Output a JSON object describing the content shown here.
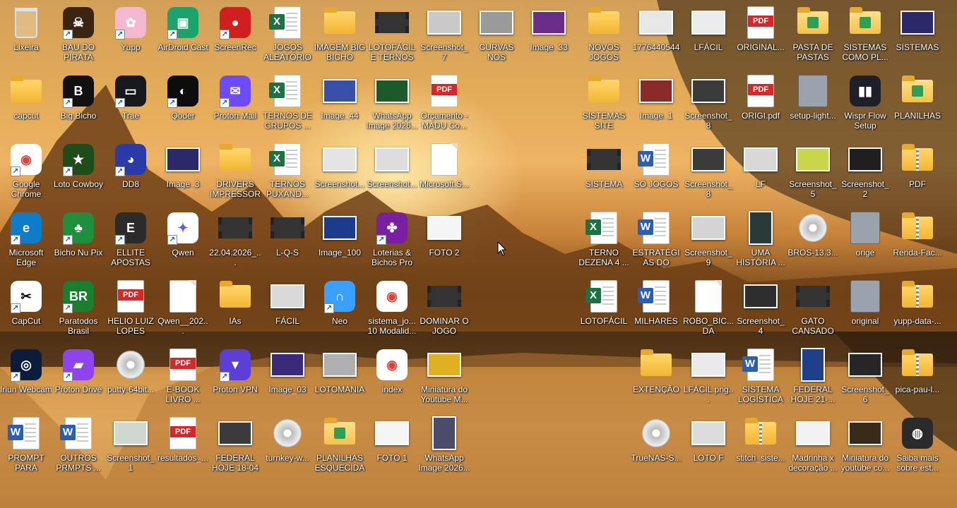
{
  "desktop": {
    "icons": [
      {
        "label": "Lixeira",
        "kind": "trash",
        "shortcut": false,
        "col": 0,
        "row": 0
      },
      {
        "label": "BAU DO PIRATA",
        "kind": "app",
        "color": "#3a2412",
        "glyph": "☠",
        "shortcut": true,
        "col": 1,
        "row": 0
      },
      {
        "label": "Yupp",
        "kind": "app",
        "color": "#f3b8d0",
        "glyph": "✿",
        "shortcut": true,
        "col": 2,
        "row": 0
      },
      {
        "label": "AirDroid Cast",
        "kind": "app",
        "color": "#1aa36b",
        "glyph": "▣",
        "shortcut": true,
        "col": 3,
        "row": 0
      },
      {
        "label": "ScreenRec",
        "kind": "app",
        "color": "#d01f1f",
        "glyph": "●",
        "shortcut": true,
        "col": 4,
        "row": 0
      },
      {
        "label": "JOGOS ALEATÓRIOS",
        "kind": "excel",
        "shortcut": false,
        "col": 5,
        "row": 0
      },
      {
        "label": "IMAGEM BIG BICHO",
        "kind": "folder",
        "shortcut": false,
        "col": 6,
        "row": 0
      },
      {
        "label": "LOTOFÁCIL E TERNOS D...",
        "kind": "video",
        "shortcut": false,
        "col": 7,
        "row": 0
      },
      {
        "label": "Screenshot_7",
        "kind": "img",
        "color": "#c9c9c9",
        "shortcut": false,
        "col": 8,
        "row": 0
      },
      {
        "label": "CURVAS NOS NÚMEROS",
        "kind": "img",
        "color": "#9a9a9a",
        "shortcut": false,
        "col": 9,
        "row": 0
      },
      {
        "label": "Image_33",
        "kind": "img",
        "color": "#6b2d8a",
        "shortcut": false,
        "col": 10,
        "row": 0
      },
      {
        "label": "capcut",
        "kind": "folder",
        "shortcut": false,
        "col": 0,
        "row": 1
      },
      {
        "label": "Big Bicho",
        "kind": "app",
        "color": "#111111",
        "glyph": "B",
        "shortcut": true,
        "col": 1,
        "row": 1
      },
      {
        "label": "Trae",
        "kind": "app",
        "color": "#17191c",
        "glyph": "▭",
        "shortcut": true,
        "col": 2,
        "row": 1
      },
      {
        "label": "Qoder",
        "kind": "app",
        "color": "#0d0d0d",
        "glyph": "◐",
        "shortcut": true,
        "col": 3,
        "row": 1
      },
      {
        "label": "Proton Mail",
        "kind": "app",
        "color": "#6d4aff",
        "glyph": "✉",
        "shortcut": true,
        "col": 4,
        "row": 1
      },
      {
        "label": "TERNOS DE GRUPOS ...",
        "kind": "excel",
        "shortcut": false,
        "col": 5,
        "row": 1
      },
      {
        "label": "Image_44",
        "kind": "img",
        "color": "#3a4fa8",
        "shortcut": false,
        "col": 6,
        "row": 1
      },
      {
        "label": "WhatsApp Image 2026...",
        "kind": "img",
        "color": "#1d5a2a",
        "shortcut": false,
        "col": 7,
        "row": 1
      },
      {
        "label": "Orçamento - MADU Co...",
        "kind": "pdf",
        "shortcut": false,
        "col": 8,
        "row": 1
      },
      {
        "label": "Google Chrome",
        "kind": "app",
        "color": "#ffffff",
        "glyph": "◉",
        "glyphColor": "#db4437",
        "shortcut": true,
        "col": 0,
        "row": 2
      },
      {
        "label": "Loto Cowboy",
        "kind": "app",
        "color": "#1f4d1a",
        "glyph": "★",
        "shortcut": true,
        "col": 1,
        "row": 2
      },
      {
        "label": "DD8",
        "kind": "app",
        "color": "#2a3aa8",
        "glyph": "◕",
        "shortcut": true,
        "col": 2,
        "row": 2
      },
      {
        "label": "Image_3",
        "kind": "img",
        "color": "#2a2a6a",
        "shortcut": false,
        "col": 3,
        "row": 2
      },
      {
        "label": "DRIVERS IMPRESSORA",
        "kind": "folder",
        "shortcut": false,
        "col": 4,
        "row": 2
      },
      {
        "label": "TERNOS PUXAND...",
        "kind": "excel",
        "shortcut": false,
        "col": 5,
        "row": 2
      },
      {
        "label": "Screenshot...",
        "kind": "img",
        "color": "#e4e4e4",
        "shortcut": false,
        "col": 6,
        "row": 2
      },
      {
        "label": "Screenshot...",
        "kind": "img",
        "color": "#dddddd",
        "shortcut": false,
        "col": 7,
        "row": 2
      },
      {
        "label": "Microsoft.S...",
        "kind": "file",
        "shortcut": false,
        "col": 8,
        "row": 2
      },
      {
        "label": "Microsoft Edge",
        "kind": "app",
        "color": "#0f7cc9",
        "glyph": "e",
        "shortcut": true,
        "col": 0,
        "row": 3
      },
      {
        "label": "Bicho Nu Pix",
        "kind": "app",
        "color": "#1e8f3a",
        "glyph": "♣",
        "shortcut": true,
        "col": 1,
        "row": 3
      },
      {
        "label": "ELLITE APOSTAS",
        "kind": "app",
        "color": "#2b2b2b",
        "glyph": "E",
        "shortcut": true,
        "col": 2,
        "row": 3
      },
      {
        "label": "Qwen",
        "kind": "app",
        "color": "#ffffff",
        "glyph": "✦",
        "glyphColor": "#615ced",
        "shortcut": true,
        "col": 3,
        "row": 3
      },
      {
        "label": "22.04.2026_...",
        "kind": "video",
        "shortcut": false,
        "col": 4,
        "row": 3
      },
      {
        "label": "L-Q-S",
        "kind": "video",
        "shortcut": false,
        "col": 5,
        "row": 3
      },
      {
        "label": "Image_100",
        "kind": "img",
        "color": "#1b3c8a",
        "shortcut": false,
        "col": 6,
        "row": 3
      },
      {
        "label": "Loterias & Bichos Pro",
        "kind": "app",
        "color": "#7b1fa2",
        "glyph": "✤",
        "shortcut": true,
        "col": 7,
        "row": 3
      },
      {
        "label": "FOTO 2",
        "kind": "img",
        "color": "#f5f5f5",
        "shortcut": false,
        "col": 8,
        "row": 3
      },
      {
        "label": "CapCut",
        "kind": "app",
        "color": "#ffffff",
        "glyph": "✂",
        "glyphColor": "#000000",
        "shortcut": true,
        "col": 0,
        "row": 4
      },
      {
        "label": "Paratodos Brasil",
        "kind": "app",
        "color": "#1b7d2e",
        "glyph": "BR",
        "shortcut": true,
        "col": 1,
        "row": 4
      },
      {
        "label": "HELIO LUIZ LOPES",
        "kind": "pdf",
        "shortcut": false,
        "col": 2,
        "row": 4
      },
      {
        "label": "Qwen__202...",
        "kind": "file",
        "shortcut": false,
        "col": 3,
        "row": 4
      },
      {
        "label": "IAs",
        "kind": "folder",
        "shortcut": false,
        "col": 4,
        "row": 4
      },
      {
        "label": "FÁCIL",
        "kind": "img",
        "color": "#d9d9d9",
        "shortcut": false,
        "col": 5,
        "row": 4
      },
      {
        "label": "Neo",
        "kind": "app",
        "color": "#3aa0ff",
        "glyph": "∩",
        "shortcut": true,
        "col": 6,
        "row": 4
      },
      {
        "label": "sistema_jo... 10 Modalid...",
        "kind": "app",
        "color": "#ffffff",
        "glyph": "◉",
        "glyphColor": "#db4437",
        "shortcut": false,
        "col": 7,
        "row": 4
      },
      {
        "label": "DOMINAR O JOGO",
        "kind": "video",
        "shortcut": false,
        "col": 8,
        "row": 4
      },
      {
        "label": "Iriun Webcam",
        "kind": "app",
        "color": "#0b1d3a",
        "glyph": "◎",
        "shortcut": true,
        "col": 0,
        "row": 5
      },
      {
        "label": "Proton Drive",
        "kind": "app",
        "color": "#8e44ec",
        "glyph": "▰",
        "shortcut": true,
        "col": 1,
        "row": 5
      },
      {
        "label": "putty-64bit...",
        "kind": "disc",
        "shortcut": false,
        "col": 2,
        "row": 5
      },
      {
        "label": "E-BOOK LIVRO ...",
        "kind": "pdf",
        "shortcut": false,
        "col": 3,
        "row": 5
      },
      {
        "label": "Proton VPN",
        "kind": "app",
        "color": "#5b3fd6",
        "glyph": "▼",
        "shortcut": true,
        "col": 4,
        "row": 5
      },
      {
        "label": "Image_03",
        "kind": "img",
        "color": "#3b2a7a",
        "shortcut": false,
        "col": 5,
        "row": 5
      },
      {
        "label": "LOTOMANIA",
        "kind": "img",
        "color": "#b0b0b0",
        "shortcut": false,
        "col": 6,
        "row": 5
      },
      {
        "label": "index",
        "kind": "app",
        "color": "#ffffff",
        "glyph": "◉",
        "glyphColor": "#db4437",
        "shortcut": false,
        "col": 7,
        "row": 5
      },
      {
        "label": "Miniatura do Youtube M...",
        "kind": "img",
        "color": "#e0b020",
        "shortcut": false,
        "col": 8,
        "row": 5
      },
      {
        "label": "PROMPT PARA SISTE...",
        "kind": "word",
        "shortcut": false,
        "col": 0,
        "row": 6
      },
      {
        "label": "OUTROS PRMPTS ...",
        "kind": "word",
        "shortcut": false,
        "col": 1,
        "row": 6
      },
      {
        "label": "Screenshot_1",
        "kind": "img",
        "color": "#cfd8cf",
        "shortcut": false,
        "col": 2,
        "row": 6
      },
      {
        "label": "resultados_...",
        "kind": "pdf",
        "shortcut": false,
        "col": 3,
        "row": 6
      },
      {
        "label": "FEDERAL HOJE 18-04",
        "kind": "img",
        "color": "#3b3b3b",
        "shortcut": false,
        "col": 4,
        "row": 6
      },
      {
        "label": "turnkey-w...",
        "kind": "disc",
        "shortcut": false,
        "col": 5,
        "row": 6
      },
      {
        "label": "PLANILHAS ESQUECIDAS",
        "kind": "folder",
        "variant": "g",
        "shortcut": false,
        "col": 6,
        "row": 6
      },
      {
        "label": "FOTO 1",
        "kind": "img",
        "color": "#f5f5f5",
        "shortcut": false,
        "col": 7,
        "row": 6
      },
      {
        "label": "WhatsApp Image 2026...",
        "kind": "img",
        "tall": true,
        "color": "#4a4a6a",
        "shortcut": false,
        "col": 8,
        "row": 6
      },
      {
        "label": "NOVOS JOGOS",
        "kind": "folder",
        "shortcut": false,
        "col": 11,
        "row": 0
      },
      {
        "label": "1776440544",
        "kind": "img",
        "color": "#e7e7e7",
        "shortcut": false,
        "col": 12,
        "row": 0
      },
      {
        "label": "LFÁCIL",
        "kind": "img",
        "color": "#ececec",
        "shortcut": false,
        "col": 13,
        "row": 0
      },
      {
        "label": "ORIGINAL...",
        "kind": "pdf",
        "shortcut": false,
        "col": 14,
        "row": 0
      },
      {
        "label": "PASTA DE PASTAS",
        "kind": "folder",
        "variant": "g",
        "shortcut": false,
        "col": 15,
        "row": 0
      },
      {
        "label": "SISTEMAS COMO PL...",
        "kind": "folder",
        "variant": "g",
        "shortcut": false,
        "col": 16,
        "row": 0
      },
      {
        "label": "SISTEMAS",
        "kind": "img",
        "color": "#2a2a6a",
        "shortcut": false,
        "col": 17,
        "row": 0
      },
      {
        "label": "SISTEMAS SITE",
        "kind": "folder",
        "shortcut": false,
        "col": 11,
        "row": 1
      },
      {
        "label": "Image_1",
        "kind": "img",
        "color": "#8a2a2a",
        "shortcut": false,
        "col": 12,
        "row": 1
      },
      {
        "label": "Screenshot_8",
        "kind": "img",
        "color": "#3b3b3b",
        "shortcut": false,
        "col": 13,
        "row": 1
      },
      {
        "label": "ORIGI.pdf",
        "kind": "pdf",
        "shortcut": false,
        "col": 14,
        "row": 1
      },
      {
        "label": "setup-light...",
        "kind": "gear",
        "shortcut": false,
        "col": 15,
        "row": 1
      },
      {
        "label": "Wispr Flow Setup",
        "kind": "app",
        "color": "#1f1f2a",
        "glyph": "▮▮",
        "shortcut": false,
        "col": 16,
        "row": 1
      },
      {
        "label": "PLANILHAS",
        "kind": "folder",
        "variant": "g",
        "shortcut": false,
        "col": 17,
        "row": 1
      },
      {
        "label": "SISTEMA",
        "kind": "video",
        "shortcut": false,
        "col": 11,
        "row": 2
      },
      {
        "label": "SÓ JOGOS",
        "kind": "word",
        "shortcut": false,
        "col": 12,
        "row": 2
      },
      {
        "label": "Screenshot_8",
        "kind": "img",
        "color": "#3b3b3b",
        "shortcut": false,
        "col": 13,
        "row": 2
      },
      {
        "label": "LF",
        "kind": "img",
        "color": "#d8d8d8",
        "shortcut": false,
        "col": 14,
        "row": 2
      },
      {
        "label": "Screenshot_5",
        "kind": "img",
        "color": "#c8d64a",
        "shortcut": false,
        "col": 15,
        "row": 2
      },
      {
        "label": "Screenshot_2",
        "kind": "img",
        "color": "#1f1f1f",
        "shortcut": false,
        "col": 16,
        "row": 2
      },
      {
        "label": "PDF",
        "kind": "folder",
        "variant": "z",
        "shortcut": false,
        "col": 17,
        "row": 2
      },
      {
        "label": "TERNO DEZENA 4 ...",
        "kind": "excel",
        "shortcut": false,
        "col": 11,
        "row": 3
      },
      {
        "label": "ESTRATÉGIAS DO JOGO D...",
        "kind": "word",
        "shortcut": false,
        "col": 12,
        "row": 3
      },
      {
        "label": "Screenshot_9",
        "kind": "img",
        "color": "#d4d4d4",
        "shortcut": false,
        "col": 13,
        "row": 3
      },
      {
        "label": "UMA HISTÓRIA ...",
        "kind": "img",
        "tall": true,
        "color": "#2a3a3a",
        "shortcut": false,
        "col": 14,
        "row": 3
      },
      {
        "label": "BROS-13.3...",
        "kind": "disc",
        "shortcut": false,
        "col": 15,
        "row": 3
      },
      {
        "label": "orige",
        "kind": "gear",
        "shortcut": false,
        "col": 16,
        "row": 3
      },
      {
        "label": "Renda-Fac...",
        "kind": "folder",
        "variant": "z",
        "shortcut": false,
        "col": 17,
        "row": 3
      },
      {
        "label": "LOTOFÁCIL",
        "kind": "excel",
        "shortcut": false,
        "col": 11,
        "row": 4
      },
      {
        "label": "MILHARES",
        "kind": "word",
        "shortcut": false,
        "col": 12,
        "row": 4
      },
      {
        "label": "ROBO_BIC... DA SORTE_t...",
        "kind": "file",
        "shortcut": false,
        "col": 13,
        "row": 4
      },
      {
        "label": "Screenshot_4",
        "kind": "img",
        "color": "#2e2e2e",
        "shortcut": false,
        "col": 14,
        "row": 4
      },
      {
        "label": "GATO CANSADO",
        "kind": "video",
        "shortcut": false,
        "col": 15,
        "row": 4
      },
      {
        "label": "original",
        "kind": "gear",
        "shortcut": false,
        "col": 16,
        "row": 4
      },
      {
        "label": "yupp-data-...",
        "kind": "folder",
        "variant": "z",
        "shortcut": false,
        "col": 17,
        "row": 4
      },
      {
        "label": "EXTENÇÃO",
        "kind": "folder",
        "shortcut": false,
        "col": 12,
        "row": 5
      },
      {
        "label": "LFÁCIL.png...",
        "kind": "img",
        "color": "#eaeaea",
        "shortcut": false,
        "col": 13,
        "row": 5
      },
      {
        "label": "SISTEMA LOGÍSTICA",
        "kind": "word",
        "shortcut": false,
        "col": 14,
        "row": 5
      },
      {
        "label": "FEDERAL HOJE 21-...",
        "kind": "img",
        "tall": true,
        "color": "#1f3f8a",
        "shortcut": false,
        "col": 15,
        "row": 5
      },
      {
        "label": "Screenshot_6",
        "kind": "img",
        "color": "#262626",
        "shortcut": false,
        "col": 16,
        "row": 5
      },
      {
        "label": "pica-pau-l...",
        "kind": "folder",
        "variant": "z",
        "shortcut": false,
        "col": 17,
        "row": 5
      },
      {
        "label": "TrueNAS-S...",
        "kind": "disc",
        "shortcut": false,
        "col": 12,
        "row": 6
      },
      {
        "label": "LOTO F",
        "kind": "img",
        "color": "#dcdcdc",
        "shortcut": false,
        "col": 13,
        "row": 6
      },
      {
        "label": "stitch_siste...",
        "kind": "folder",
        "variant": "z",
        "shortcut": false,
        "col": 14,
        "row": 6
      },
      {
        "label": "Madrinha x decoração ...",
        "kind": "img",
        "color": "#f2f2f2",
        "shortcut": false,
        "col": 15,
        "row": 6
      },
      {
        "label": "Miniatura do youtube co...",
        "kind": "img",
        "color": "#3a2a1a",
        "shortcut": false,
        "col": 16,
        "row": 6
      },
      {
        "label": "Saiba mais sobre est...",
        "kind": "app",
        "color": "#2a2a2a",
        "glyph": "◍",
        "shortcut": false,
        "col": 17,
        "row": 6
      }
    ]
  }
}
